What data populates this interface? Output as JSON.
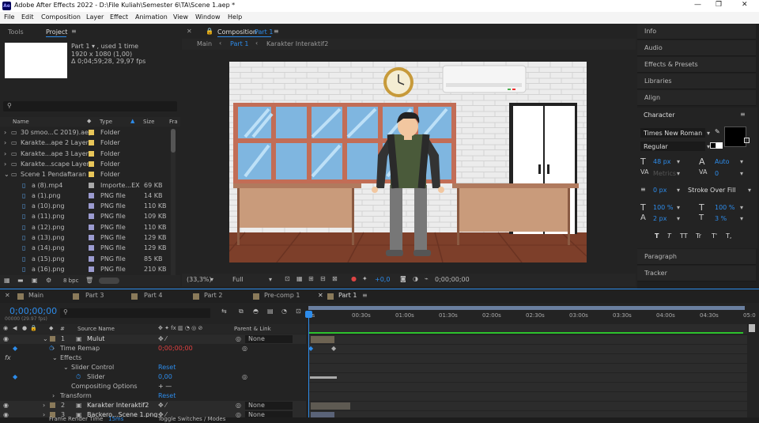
{
  "title": "Adobe After Effects 2022 - D:\\File Kuliah\\Semester 6\\TA\\Scene 1.aep *",
  "app_icon": "Ae",
  "window_controls": [
    "—",
    "❐",
    "✕"
  ],
  "menu": [
    "File",
    "Edit",
    "Composition",
    "Layer",
    "Effect",
    "Animation",
    "View",
    "Window",
    "Help"
  ],
  "project": {
    "tabs": [
      "Tools",
      "Project"
    ],
    "item_name": "Part 1 ▾ , used 1 time",
    "item_dims": "1920 x 1080 (1,00)",
    "item_duration": "Δ 0;04;59;28, 29,97 fps",
    "search_placeholder": "",
    "col_name": "Name",
    "col_type": "Type",
    "col_size": "Size",
    "col_fr": "Fra",
    "files": [
      {
        "name": "30 smoo...C 2019).aep",
        "type": "Folder",
        "size": "",
        "color": "#e8c65a",
        "kind": "folder"
      },
      {
        "name": "Karakte...ape 2 Layers",
        "type": "Folder",
        "size": "",
        "color": "#e8c65a",
        "kind": "folder"
      },
      {
        "name": "Karakte...ape 3 Layers",
        "type": "Folder",
        "size": "",
        "color": "#e8c65a",
        "kind": "folder"
      },
      {
        "name": "Karakte...scape Layers",
        "type": "Folder",
        "size": "",
        "color": "#e8c65a",
        "kind": "folder"
      },
      {
        "name": "Scene 1 Pendaftaran",
        "type": "Folder",
        "size": "",
        "color": "#e8c65a",
        "kind": "folder"
      },
      {
        "name": "a (8).mp4",
        "type": "Importe...EX",
        "size": "69 KB",
        "color": "#a9a9a9",
        "kind": "file"
      },
      {
        "name": "a (1).png",
        "type": "PNG file",
        "size": "14 KB",
        "color": "#9b9bd0",
        "kind": "file"
      },
      {
        "name": "a (10).png",
        "type": "PNG file",
        "size": "110 KB",
        "color": "#9b9bd0",
        "kind": "file"
      },
      {
        "name": "a (11).png",
        "type": "PNG file",
        "size": "109 KB",
        "color": "#9b9bd0",
        "kind": "file"
      },
      {
        "name": "a (12).png",
        "type": "PNG file",
        "size": "110 KB",
        "color": "#9b9bd0",
        "kind": "file"
      },
      {
        "name": "a (13).png",
        "type": "PNG file",
        "size": "129 KB",
        "color": "#9b9bd0",
        "kind": "file"
      },
      {
        "name": "a (14).png",
        "type": "PNG file",
        "size": "129 KB",
        "color": "#9b9bd0",
        "kind": "file"
      },
      {
        "name": "a (15).png",
        "type": "PNG file",
        "size": "85 KB",
        "color": "#9b9bd0",
        "kind": "file"
      },
      {
        "name": "a (16).png",
        "type": "PNG file",
        "size": "210 KB",
        "color": "#9b9bd0",
        "kind": "file"
      }
    ],
    "bpc": "8 bpc"
  },
  "composition": {
    "tab_prefix": "Composition",
    "tab_name": "Part 1",
    "breadcrumb": [
      "Main",
      "Part 1",
      "Karakter Interaktif2"
    ],
    "zoom": "(33,3%)",
    "resolution": "Full",
    "exposure": "+0,0",
    "timecode": "0;00;00;00"
  },
  "right_panels": [
    "Info",
    "Audio",
    "Effects & Presets",
    "Libraries",
    "Align"
  ],
  "character": {
    "title": "Character",
    "font": "Times New Roman",
    "style": "Regular",
    "size": "48 px",
    "leading": "Auto",
    "kerning": "Metrics",
    "tracking": "0",
    "stroke_width": "0 px",
    "stroke_type": "Stroke Over Fill",
    "vscale": "100 %",
    "hscale": "100 %",
    "baseline": "2 px",
    "tsume": "3 %",
    "styles": [
      "T",
      "T",
      "TT",
      "Tr",
      "T'",
      "T,"
    ]
  },
  "bottom_panels": [
    "Paragraph",
    "Tracker"
  ],
  "timeline": {
    "tabs": [
      "Main",
      "Part 3",
      "Part 4",
      "Part 2",
      "Pre-comp 1",
      "Part 1"
    ],
    "tab_colors": [
      "#8a7a5a",
      "#8a7a5a",
      "#8a7a5a",
      "#8a7a5a",
      "#8a7a5a",
      "#8a7a5a"
    ],
    "timecode": "0;00;00;00",
    "fps": "00000 (29.97 fps)",
    "col_num": "#",
    "col_source": "Source Name",
    "col_parent": "Parent & Link",
    "ruler": [
      "0s",
      "00:30s",
      "01:00s",
      "01:30s",
      "02:00s",
      "02:30s",
      "03:00s",
      "03:30s",
      "04:00s",
      "04:30s",
      "05:0"
    ],
    "layers": [
      {
        "num": "1",
        "name": "Mulut",
        "parent": "None"
      },
      {
        "label": "Time Remap",
        "value": "0;00;00;00"
      },
      {
        "label": "Effects"
      },
      {
        "label": "Slider Control",
        "value": "Reset"
      },
      {
        "label": "Slider",
        "value": "0,00"
      },
      {
        "label": "Compositing Options",
        "value": "+ —"
      },
      {
        "label": "Transform",
        "value": "Reset"
      },
      {
        "num": "2",
        "name": "Karakter Interaktif2",
        "parent": "None"
      },
      {
        "num": "3",
        "name": "Backero...Scene 1.png",
        "parent": "None"
      }
    ],
    "footer_left": "Frame Render Time",
    "footer_value": "15ms",
    "footer_right": "Toggle Switches / Modes"
  }
}
